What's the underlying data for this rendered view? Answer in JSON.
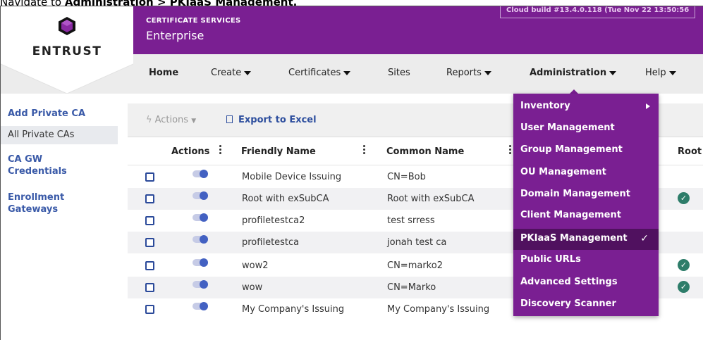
{
  "caption": {
    "prefix": "Navigate to ",
    "path": "Administration > PKIaaS Management."
  },
  "brand": {
    "name": "ENTRUST",
    "accent": "#7a1f92",
    "icon": "entrust-hex-logo-icon"
  },
  "header": {
    "pretitle": "CERTIFICATE SERVICES",
    "title": "Enterprise",
    "build": "Cloud build #13.4.0.118 (Tue Nov 22 13:50:56"
  },
  "nav": {
    "home": "Home",
    "create": "Create",
    "certificates": "Certificates",
    "sites": "Sites",
    "reports": "Reports",
    "administration": "Administration",
    "help": "Help"
  },
  "sidebar": {
    "items": [
      {
        "label": "Add Private CA"
      },
      {
        "label": "All Private CAs"
      },
      {
        "label": "CA GW Credentials"
      },
      {
        "label": "Enrollment Gateways"
      }
    ]
  },
  "toolbar": {
    "actions_label": "Actions",
    "export_label": "Export to Excel"
  },
  "table": {
    "columns": {
      "actions": "Actions",
      "friendly": "Friendly Name",
      "common": "Common Name",
      "root": "Root"
    },
    "rows": [
      {
        "friendly": "Mobile Device Issuing",
        "common": "CN=Bob",
        "root": false
      },
      {
        "friendly": "Root with exSubCA",
        "common": "Root with exSubCA",
        "root": true
      },
      {
        "friendly": "profiletestca2",
        "common": "test srress",
        "root": false
      },
      {
        "friendly": "profiletestca",
        "common": "jonah test ca",
        "root": false
      },
      {
        "friendly": "wow2",
        "common": "CN=marko2",
        "root": true
      },
      {
        "friendly": "wow",
        "common": "CN=Marko",
        "root": true
      },
      {
        "friendly": "My Company's Issuing",
        "common": "My Company's Issuing",
        "root": false
      }
    ]
  },
  "admin_menu": {
    "items": [
      {
        "label": "Inventory",
        "submenu": true
      },
      {
        "label": "User Management"
      },
      {
        "label": "Group Management"
      },
      {
        "label": "OU Management"
      },
      {
        "label": "Domain Management"
      },
      {
        "label": "Client Management"
      },
      {
        "label": "PKIaaS Management",
        "selected": true
      },
      {
        "label": "Public URLs"
      },
      {
        "label": "Advanced Settings"
      },
      {
        "label": "Discovery Scanner"
      }
    ]
  }
}
